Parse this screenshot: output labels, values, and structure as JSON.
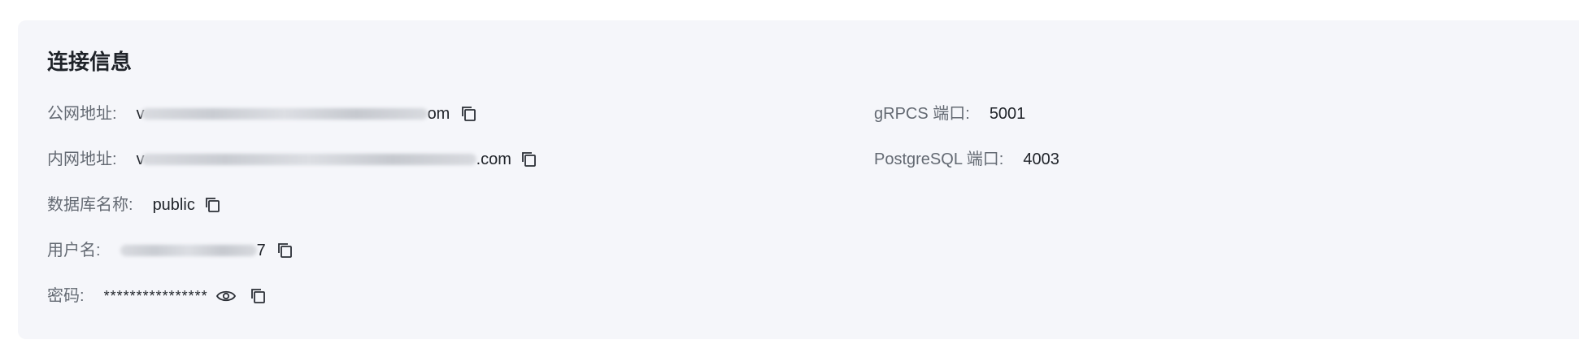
{
  "section": {
    "title": "连接信息"
  },
  "fields": {
    "public_address": {
      "label": "公网地址:",
      "value_prefix": "v",
      "value_suffix": "om"
    },
    "private_address": {
      "label": "内网地址:",
      "value_prefix": "v",
      "value_suffix": ".com"
    },
    "database_name": {
      "label": "数据库名称:",
      "value": "public"
    },
    "username": {
      "label": "用户名:",
      "value_suffix": "7"
    },
    "password": {
      "label": "密码:",
      "value": "****************"
    },
    "grpcs_port": {
      "label": "gRPCS 端口:",
      "value": "5001"
    },
    "postgresql_port": {
      "label": "PostgreSQL 端口:",
      "value": "4003"
    }
  },
  "icons": {
    "copy": "copy-icon",
    "visibility": "eye-icon"
  }
}
